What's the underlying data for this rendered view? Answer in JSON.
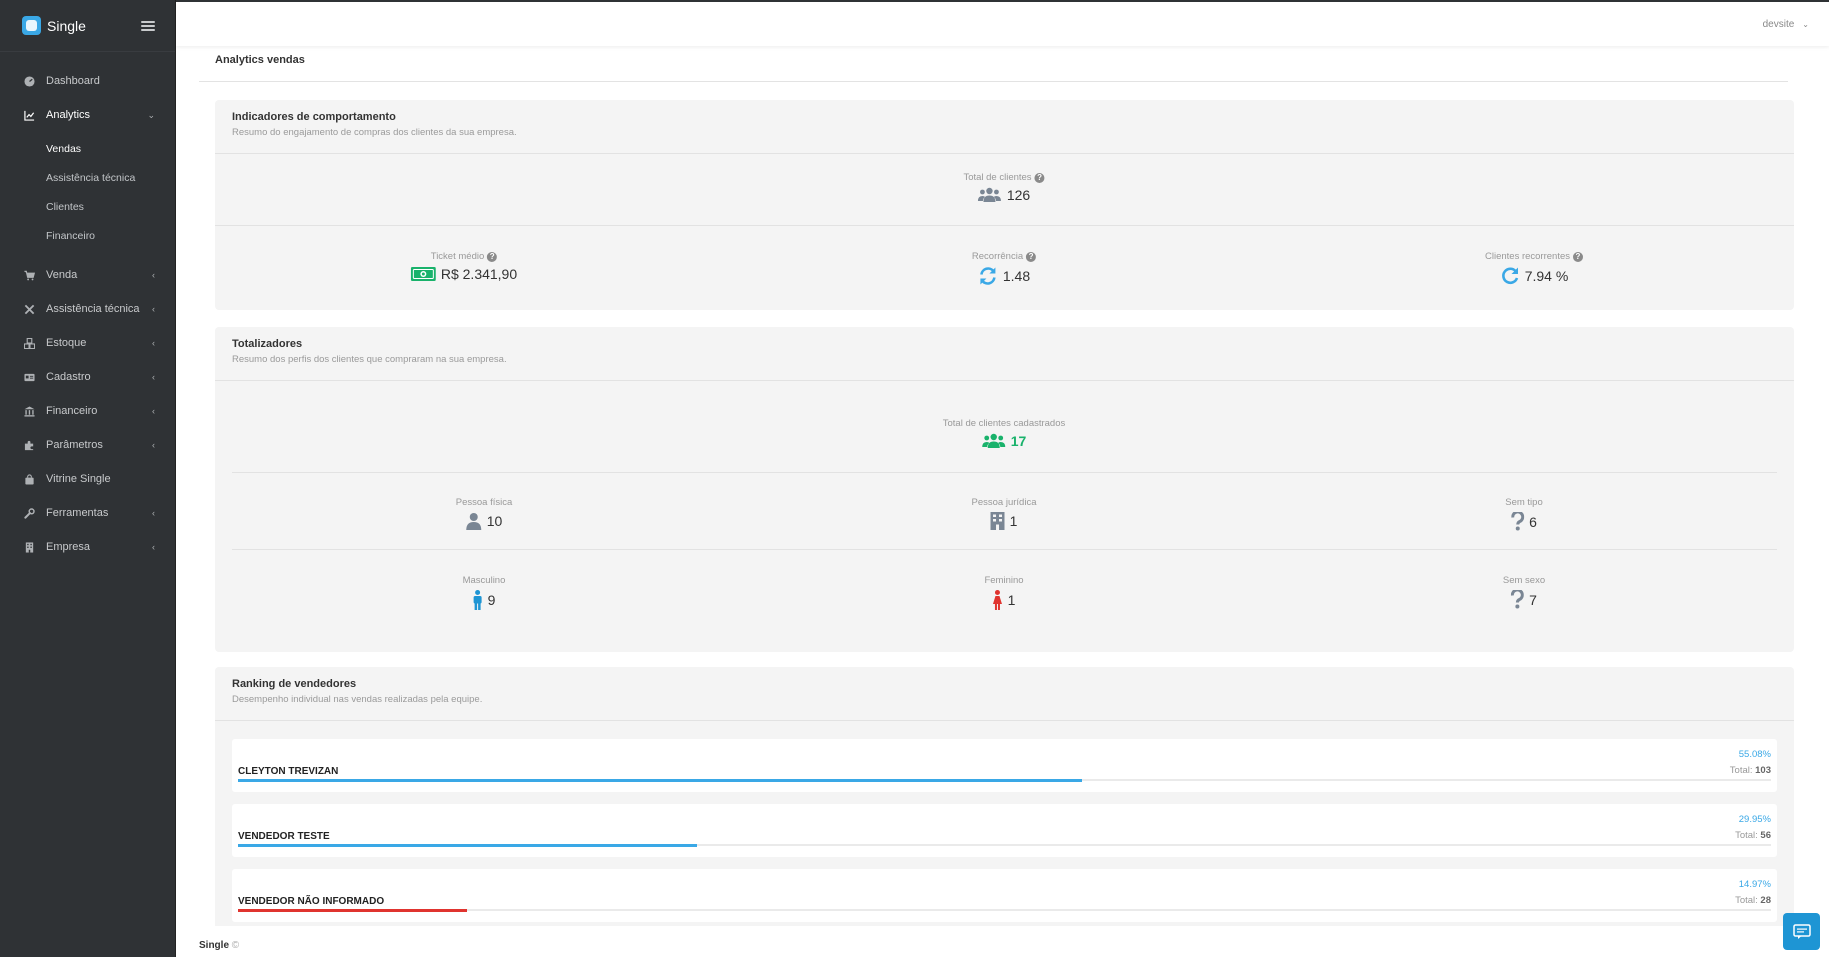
{
  "brand": {
    "name": "Single"
  },
  "topbar": {
    "user": "devsite"
  },
  "sidebar": {
    "items": [
      {
        "label": "Dashboard",
        "icon": "dashboard-icon"
      },
      {
        "label": "Analytics",
        "icon": "chart-line-icon",
        "expanded": true,
        "children": [
          "Vendas",
          "Assistência técnica",
          "Clientes",
          "Financeiro"
        ]
      },
      {
        "label": "Venda",
        "icon": "cart-icon"
      },
      {
        "label": "Assistência técnica",
        "icon": "tools-icon"
      },
      {
        "label": "Estoque",
        "icon": "cubes-icon"
      },
      {
        "label": "Cadastro",
        "icon": "id-card-icon"
      },
      {
        "label": "Financeiro",
        "icon": "bank-icon"
      },
      {
        "label": "Parâmetros",
        "icon": "puzzle-icon"
      },
      {
        "label": "Vitrine Single",
        "icon": "bag-icon"
      },
      {
        "label": "Ferramentas",
        "icon": "wrench-icon"
      },
      {
        "label": "Empresa",
        "icon": "building-icon"
      }
    ]
  },
  "page": {
    "title": "Analytics vendas"
  },
  "comportamento": {
    "title": "Indicadores de comportamento",
    "subtitle": "Resumo do engajamento de compras dos clientes da sua empresa.",
    "total_clientes": {
      "label": "Total de clientes",
      "value": "126"
    },
    "ticket_medio": {
      "label": "Ticket médio",
      "value": "R$ 2.341,90"
    },
    "recorrencia": {
      "label": "Recorrência",
      "value": "1.48"
    },
    "recorrentes": {
      "label": "Clientes recorrentes",
      "value": "7.94 %"
    }
  },
  "totalizadores": {
    "title": "Totalizadores",
    "subtitle": "Resumo dos perfis dos clientes que compraram na sua empresa.",
    "cadastrados": {
      "label": "Total de clientes cadastrados",
      "value": "17"
    },
    "pessoa_fisica": {
      "label": "Pessoa física",
      "value": "10"
    },
    "pessoa_juridica": {
      "label": "Pessoa jurídica",
      "value": "1"
    },
    "sem_tipo": {
      "label": "Sem tipo",
      "value": "6"
    },
    "masculino": {
      "label": "Masculino",
      "value": "9"
    },
    "feminino": {
      "label": "Feminino",
      "value": "1"
    },
    "sem_sexo": {
      "label": "Sem sexo",
      "value": "7"
    }
  },
  "ranking": {
    "title": "Ranking de vendedores",
    "subtitle": "Desempenho individual nas vendas realizadas pela equipe.",
    "total_label": "Total:",
    "rows": [
      {
        "name": "CLEYTON TREVIZAN",
        "percent": "55.08%",
        "fraction": 0.5508,
        "total": "103",
        "color": "#3aa8e6"
      },
      {
        "name": "VENDEDOR TESTE",
        "percent": "29.95%",
        "fraction": 0.2995,
        "total": "56",
        "color": "#3aa8e6"
      },
      {
        "name": "VENDEDOR NÃO INFORMADO",
        "percent": "14.97%",
        "fraction": 0.1497,
        "total": "28",
        "color": "#e0342f"
      }
    ]
  },
  "footer": {
    "brand": "Single",
    "copyright": "©"
  },
  "colors": {
    "accent": "#3aa8e6",
    "green": "#19b26b",
    "sidebar": "#2f3235",
    "female": "#e0342f",
    "male": "#1e95d4"
  }
}
